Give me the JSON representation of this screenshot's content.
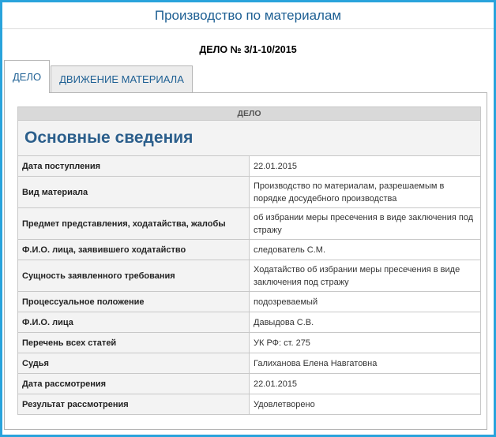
{
  "header": {
    "title": "Производство по материалам"
  },
  "case": {
    "number": "ДЕЛО № 3/1-10/2015"
  },
  "tabs": [
    {
      "label": "ДЕЛО",
      "active": true
    },
    {
      "label": "ДВИЖЕНИЕ МАТЕРИАЛА",
      "active": false
    }
  ],
  "table": {
    "caption": "ДЕЛО",
    "section_title": "Основные сведения",
    "rows": [
      {
        "label": "Дата поступления",
        "value": "22.01.2015"
      },
      {
        "label": "Вид материала",
        "value": "Производство по материалам, разрешаемым в порядке досудебного производства"
      },
      {
        "label": "Предмет представления, ходатайства, жалобы",
        "value": "об избрании меры пресечения в виде заключения под стражу"
      },
      {
        "label": "Ф.И.О. лица, заявившего ходатайство",
        "value": "следователь С.М."
      },
      {
        "label": "Сущность заявленного требования",
        "value": "Ходатайство об избрании меры пресечения в виде заключения под стражу"
      },
      {
        "label": "Процессуальное положение",
        "value": "подозреваемый"
      },
      {
        "label": "Ф.И.О. лица",
        "value": "Давыдова С.В."
      },
      {
        "label": "Перечень всех статей",
        "value": "УК РФ: ст. 275"
      },
      {
        "label": "Судья",
        "value": "Галиханова Елена Навгатовна"
      },
      {
        "label": "Дата рассмотрения",
        "value": "22.01.2015"
      },
      {
        "label": "Результат рассмотрения",
        "value": "Удовлетворено"
      }
    ]
  },
  "colors": {
    "accent_border": "#29a3dc",
    "title_text": "#1d5f93"
  }
}
